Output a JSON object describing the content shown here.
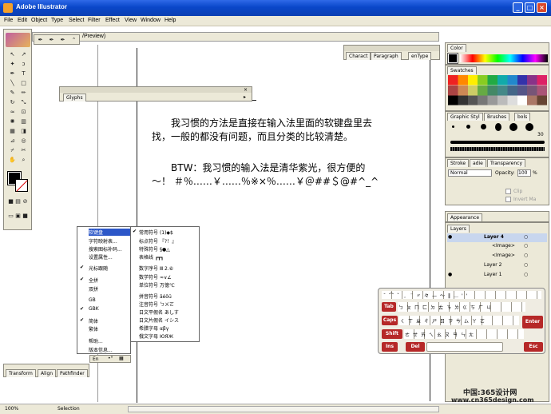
{
  "app": {
    "title": "Adobe Illustrator",
    "doc_tab": "/Preview)"
  },
  "menus": [
    "File",
    "Edit",
    "Object",
    "Type",
    "Select",
    "Filter",
    "Effect",
    "View",
    "Window",
    "Help"
  ],
  "window_controls": [
    "_",
    "□",
    "×"
  ],
  "panels": {
    "glyphs": "Glyphs",
    "character": [
      "Charact",
      "Paragraph",
      "enType"
    ],
    "color": "Color",
    "swatches": "Swatches",
    "brushes": [
      "Graphic Styl",
      "Brushes",
      "bols"
    ],
    "brush_size": "30",
    "stroke": [
      "Stroke",
      "adie",
      "Transparency"
    ],
    "blend_mode": "Normal",
    "opacity_label": "Opacity:",
    "opacity_value": "100",
    "opacity_unit": "%",
    "clip": "Clip",
    "invert": "Invert Ma",
    "appearance": "Appearance",
    "layers": "Layers",
    "layer_rows": [
      "Layer 4",
      "<Image>",
      "<Image>",
      "Layer 2",
      "Layer 1"
    ],
    "transform": [
      "Transform",
      "Align",
      "Pathfinder"
    ]
  },
  "body_text": {
    "p1": "我习惯的方法是直接在输入法里面的软键盘里去找，一般的都没有问题，而且分类的比较清楚。",
    "p2": "BTW：我习惯的输入法是清华紫光，很方便的～！ ＃％……￥……％※×％……￥＠##＄@#^_^"
  },
  "ime_menu_left": [
    "软键盘",
    "字符映射表...",
    "搜索图标补码...",
    "设置属性...",
    "光标跟随",
    "全拼",
    "双拼",
    "GB",
    "GBK",
    "简体",
    "繁体",
    "帮助...",
    "版本信息..."
  ],
  "ime_menu_right": [
    {
      "name": "常用符号",
      "sample": "(1)◆$"
    },
    {
      "name": "标点符号",
      "sample": "『?！』"
    },
    {
      "name": "特殊符号",
      "sample": "§●△"
    },
    {
      "name": "表格线",
      "sample": "┏┳┓"
    },
    {
      "name": "数字序号",
      "sample": "Ⅲ 2.⑥"
    },
    {
      "name": "数学符号",
      "sample": "≈∨∠"
    },
    {
      "name": "单位符号",
      "sample": "万億℃"
    },
    {
      "name": "拼音符号",
      "sample": "āéǒü"
    },
    {
      "name": "注音符号",
      "sample": "ㄅㄨㄛ"
    },
    {
      "name": "日文平假名",
      "sample": "あしす"
    },
    {
      "name": "日文片假名",
      "sample": "イシス"
    },
    {
      "name": "希腊字母",
      "sample": "αβγ"
    },
    {
      "name": "俄文字母",
      "sample": "ЮЯЖ"
    }
  ],
  "ime_status": "En",
  "keyboard": {
    "keys": [
      "Tab",
      "Caps",
      "Shift",
      "Ins",
      "Del",
      "Esc",
      "Enter"
    ],
    "rows": [
      "ˉ⌒ˇ﹐¨〃々—～‖…''",
      "ㄅㄆㄇㄈㄉㄊㄋㄌㄍㄎㄏㄐ",
      "ㄑㄒㄓㄔㄕㄖㄗㄘㄙㄚㄛ",
      "ㄜㄝㄞㄟㄠㄡㄢㄣㄤ"
    ]
  },
  "status": {
    "zoom": "100%",
    "tool": "Selection"
  },
  "watermark": {
    "line1": "中国:365设计网",
    "line2": "www.cn365design.com"
  },
  "colors": {
    "titlebar": "#0a47c9",
    "keyboard_red": "#b62828",
    "panel_bg": "#ece9d8"
  }
}
